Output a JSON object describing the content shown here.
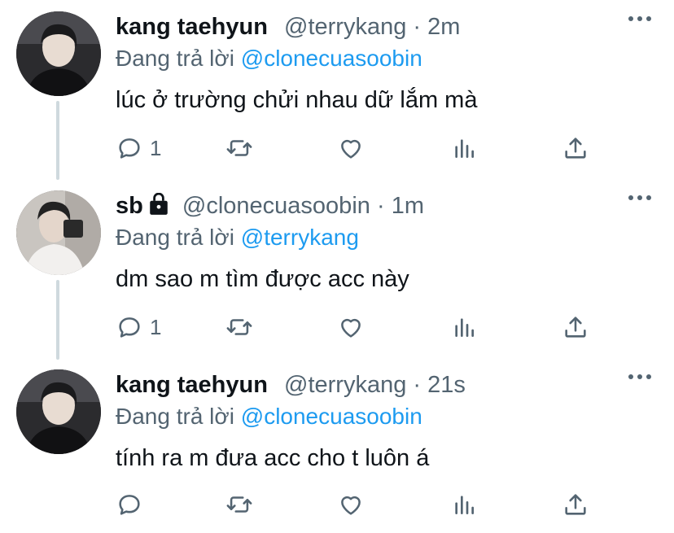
{
  "tweets": [
    {
      "name": "kang taehyun",
      "handle": "@terrykang",
      "separator": "·",
      "time": "2m",
      "reply_prefix": "Đang trả lời",
      "reply_to": "@clonecuasoobin",
      "text": "lúc ở trường chửi nhau dữ lắm mà",
      "reply_count": "1",
      "locked": false
    },
    {
      "name": "sb",
      "handle": "@clonecuasoobin",
      "separator": "·",
      "time": "1m",
      "reply_prefix": "Đang trả lời",
      "reply_to": "@terrykang",
      "text": "dm sao m tìm được acc này",
      "reply_count": "1",
      "locked": true
    },
    {
      "name": "kang taehyun",
      "handle": "@terrykang",
      "separator": "·",
      "time": "21s",
      "reply_prefix": "Đang trả lời",
      "reply_to": "@clonecuasoobin",
      "text": "tính ra m đưa acc cho t luôn á",
      "reply_count": "",
      "locked": false
    }
  ],
  "icons": {
    "reply": "reply-icon",
    "retweet": "retweet-icon",
    "like": "like-icon",
    "analytics": "analytics-icon",
    "share": "share-icon",
    "more": "more-icon",
    "lock": "lock-icon"
  },
  "colors": {
    "text": "#0f1419",
    "secondary": "#536471",
    "link": "#1d9bf0",
    "thread_line": "#cfd9de"
  }
}
